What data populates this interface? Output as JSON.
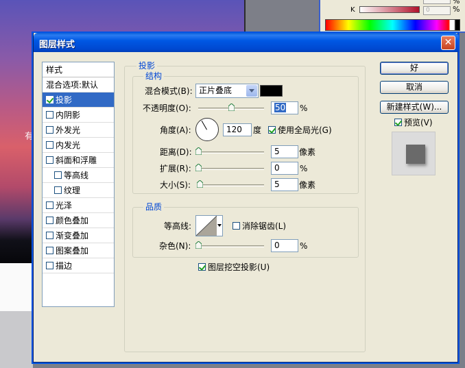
{
  "background": {
    "edge_text": "有",
    "color_panel": {
      "k_label": "K",
      "k_value": "0",
      "pct": "%"
    }
  },
  "dialog": {
    "title": "图层样式",
    "close_icon": "✕"
  },
  "style_list": {
    "header": "样式",
    "blend_options": "混合选项:默认",
    "items": [
      {
        "label": "投影",
        "checked": true,
        "selected": true,
        "sub": false
      },
      {
        "label": "内阴影",
        "checked": false,
        "selected": false,
        "sub": false
      },
      {
        "label": "外发光",
        "checked": false,
        "selected": false,
        "sub": false
      },
      {
        "label": "内发光",
        "checked": false,
        "selected": false,
        "sub": false
      },
      {
        "label": "斜面和浮雕",
        "checked": false,
        "selected": false,
        "sub": false
      },
      {
        "label": "等高线",
        "checked": false,
        "selected": false,
        "sub": true
      },
      {
        "label": "纹理",
        "checked": false,
        "selected": false,
        "sub": true
      },
      {
        "label": "光泽",
        "checked": false,
        "selected": false,
        "sub": false
      },
      {
        "label": "颜色叠加",
        "checked": false,
        "selected": false,
        "sub": false
      },
      {
        "label": "渐变叠加",
        "checked": false,
        "selected": false,
        "sub": false
      },
      {
        "label": "图案叠加",
        "checked": false,
        "selected": false,
        "sub": false
      },
      {
        "label": "描边",
        "checked": false,
        "selected": false,
        "sub": false
      }
    ]
  },
  "shadow": {
    "group_title": "投影",
    "structure": {
      "title": "结构",
      "blend_mode_label": "混合模式(B):",
      "blend_mode_value": "正片叠底",
      "shadow_color": "#000000",
      "opacity_label": "不透明度(O):",
      "opacity_value": "50",
      "opacity_unit": "%",
      "angle_label": "角度(A):",
      "angle_value": "120",
      "angle_unit": "度",
      "global_light_label": "使用全局光(G)",
      "global_light_checked": true,
      "distance_label": "距离(D):",
      "distance_value": "5",
      "distance_unit": "像素",
      "spread_label": "扩展(R):",
      "spread_value": "0",
      "spread_unit": "%",
      "size_label": "大小(S):",
      "size_value": "5",
      "size_unit": "像素"
    },
    "quality": {
      "title": "品质",
      "contour_label": "等高线:",
      "anti_alias_label": "消除锯齿(L)",
      "anti_alias_checked": false,
      "noise_label": "杂色(N):",
      "noise_value": "0",
      "noise_unit": "%"
    },
    "knockout_label": "图层挖空投影(U)",
    "knockout_checked": true
  },
  "buttons": {
    "ok": "好",
    "cancel": "取消",
    "new_style": "新建样式(W)...",
    "preview_label": "预览(V)",
    "preview_checked": true
  }
}
